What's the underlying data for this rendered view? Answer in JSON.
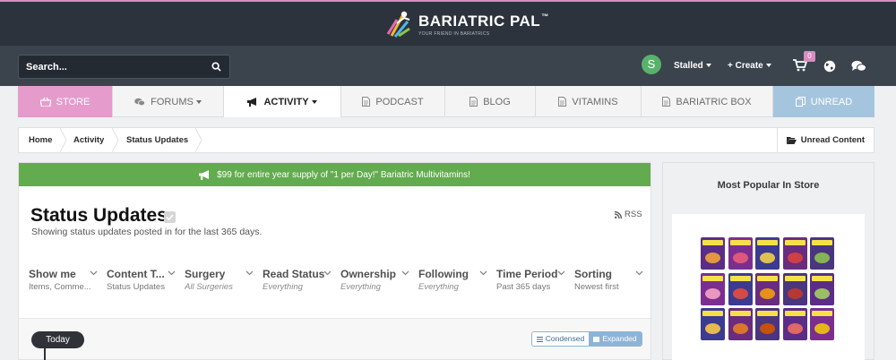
{
  "brand": {
    "name": "BARIATRIC PAL",
    "trademark": "™",
    "tagline": "YOUR FRIEND IN BARIATRICS",
    "accent_color": "#d98cc0"
  },
  "userbar": {
    "search_placeholder": "Search...",
    "avatar_letter": "S",
    "user_label": "Stalled",
    "create_label": "+ Create",
    "cart_count": "0"
  },
  "nav": {
    "items": [
      {
        "label": "STORE",
        "icon": "basket-icon"
      },
      {
        "label": "FORUMS",
        "icon": "chat-bubbles-icon"
      },
      {
        "label": "ACTIVITY",
        "icon": "megaphone-icon"
      },
      {
        "label": "PODCAST",
        "icon": "document-icon"
      },
      {
        "label": "BLOG",
        "icon": "document-icon"
      },
      {
        "label": "VITAMINS",
        "icon": "document-icon"
      },
      {
        "label": "BARIATRIC BOX",
        "icon": "document-icon"
      },
      {
        "label": "UNREAD",
        "icon": "copy-icon"
      }
    ]
  },
  "breadcrumb": {
    "items": [
      "Home",
      "Activity",
      "Status Updates"
    ],
    "right_label": "Unread Content"
  },
  "promo": {
    "text": "$99 for entire year supply of \"1 per Day!\" Bariatric Multivitamins!",
    "color": "#62ab4e"
  },
  "page": {
    "title": "Status Updates",
    "subtitle": "Showing status updates posted in for the last 365 days.",
    "rss_label": "RSS"
  },
  "filters": [
    {
      "label": "Show me",
      "value": "Items, Comme..."
    },
    {
      "label": "Content T...",
      "value": "Status Updates"
    },
    {
      "label": "Surgery",
      "value": "All Surgeries"
    },
    {
      "label": "Read Status",
      "value": "Everything"
    },
    {
      "label": "Ownership",
      "value": "Everything"
    },
    {
      "label": "Following",
      "value": "Everything"
    },
    {
      "label": "Time Period",
      "value": "Past 365 days"
    },
    {
      "label": "Sorting",
      "value": "Newest first"
    }
  ],
  "feed": {
    "today_label": "Today",
    "condensed_label": "Condensed",
    "expanded_label": "Expanded"
  },
  "sidebar": {
    "title": "Most Popular In Store"
  }
}
